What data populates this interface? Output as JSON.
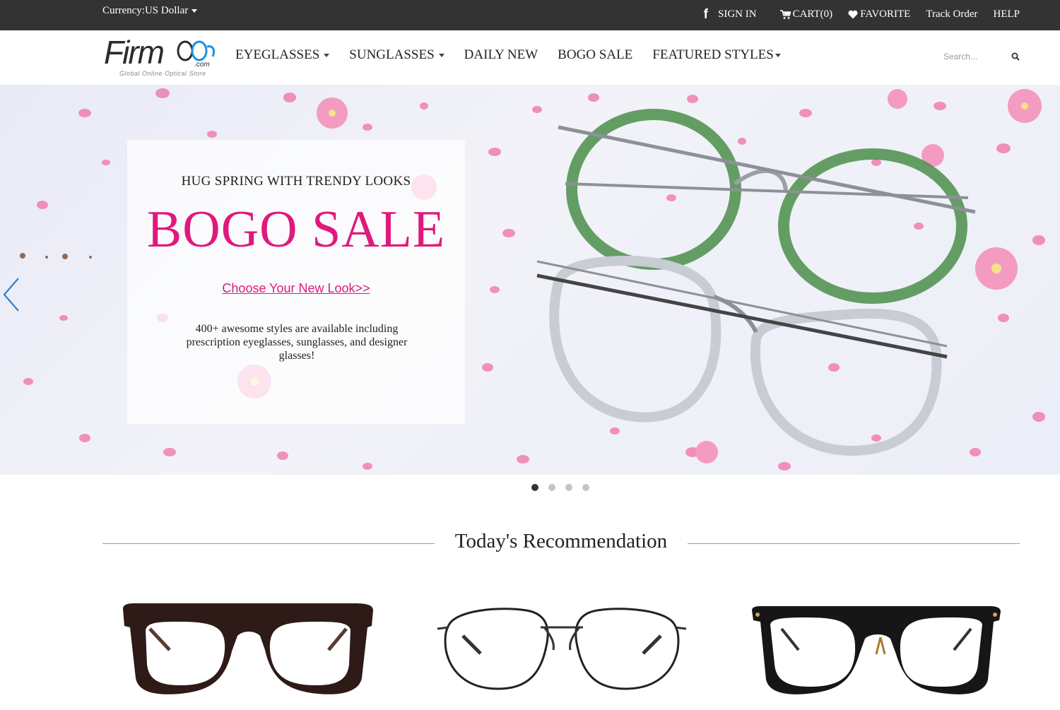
{
  "topbar": {
    "currency_label": "Currency:US Dollar",
    "links": {
      "sign_in": "SIGN IN",
      "cart": "CART(0)",
      "favorite": "FAVORITE",
      "track_order": "Track Order",
      "help": "HELP"
    },
    "icons": [
      "facebook-icon",
      "cart-icon",
      "heart-icon"
    ]
  },
  "header": {
    "logo": {
      "word": "Firm",
      "com": ".com",
      "tagline": "Global Online Optical Store"
    },
    "nav": [
      {
        "label": "EYEGLASSES",
        "has_dropdown": true
      },
      {
        "label": "SUNGLASSES",
        "has_dropdown": true
      },
      {
        "label": "DAILY NEW",
        "has_dropdown": false
      },
      {
        "label": "BOGO SALE",
        "has_dropdown": false
      },
      {
        "label": "FEATURED STYLES",
        "has_dropdown": true
      }
    ],
    "search": {
      "placeholder": "Search..."
    }
  },
  "banner": {
    "subtitle": "HUG SPRING WITH TRENDY LOOKS",
    "title": "BOGO SALE",
    "link": "Choose Your New Look>>",
    "description": "400+ awesome styles are available including prescription eyeglasses, sunglasses, and designer glasses!",
    "slides": 4,
    "active_slide": 1
  },
  "recommendation": {
    "title": "Today's Recommendation",
    "products": [
      {
        "style": "thick-tortoise-square-frame"
      },
      {
        "style": "thin-metal-round-frame"
      },
      {
        "style": "black-square-frame"
      }
    ]
  },
  "colors": {
    "topbar": "#333333",
    "accent_pink": "#e0197c",
    "logo_blue": "#1e90e0"
  }
}
